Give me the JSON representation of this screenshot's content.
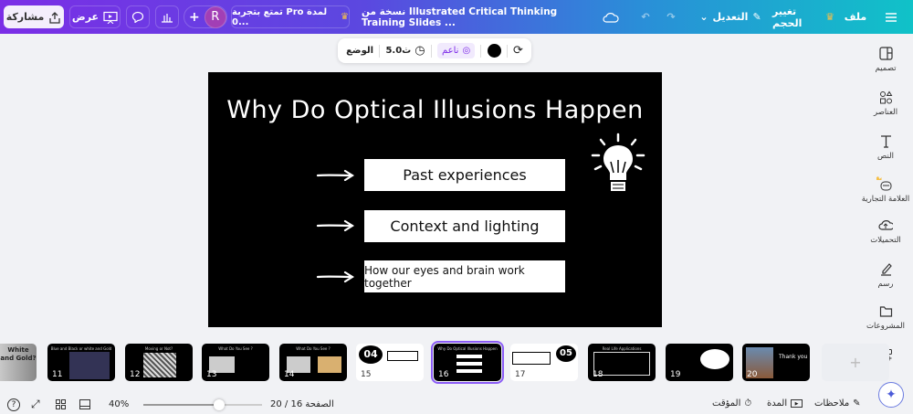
{
  "topbar": {
    "menu": "ملف",
    "resize": "تغيير الحجم",
    "edit": "التعديل",
    "title": "نسخة من Illustrated Critical Thinking Training Slides ...",
    "pro_trial": "تمتع بتجربة Pro لمدة 0...",
    "avatar": "R",
    "present": "عرض",
    "share": "مشاركة"
  },
  "toolbar": {
    "smooth": "ناعم",
    "duration": "5.0ث",
    "mode": "الوضع",
    "color": "#000000"
  },
  "slide": {
    "title": "Why Do Optical Illusions Happen",
    "items": [
      "Past experiences",
      "Context and lighting",
      "How our eyes and brain work together"
    ]
  },
  "sidebar": {
    "items": [
      "تصميم",
      "العناصر",
      "النص",
      "العلامة التجارية",
      "التحميلات",
      "رسم",
      "المشروعات"
    ]
  },
  "thumbnails": [
    {
      "num": "",
      "title": "White and Gold?"
    },
    {
      "num": "11",
      "title": "Blue and Black or white and Gold"
    },
    {
      "num": "12",
      "title": "Moving or Not?"
    },
    {
      "num": "13",
      "title": "What Do You See ?"
    },
    {
      "num": "14",
      "title": "What Do You See ?"
    },
    {
      "num": "15",
      "title": "04"
    },
    {
      "num": "16",
      "title": "Why Do Optical Illusions Happen"
    },
    {
      "num": "17",
      "title": "05"
    },
    {
      "num": "18",
      "title": "Real Life Applications"
    },
    {
      "num": "19",
      "title": ""
    },
    {
      "num": "20",
      "title": "Thank you"
    }
  ],
  "bottombar": {
    "notes": "ملاحظات",
    "duration": "المدة",
    "timer": "المؤقت",
    "page": "الصفحة 16 / 20",
    "zoom": "40%",
    "zoom_value": 40
  }
}
